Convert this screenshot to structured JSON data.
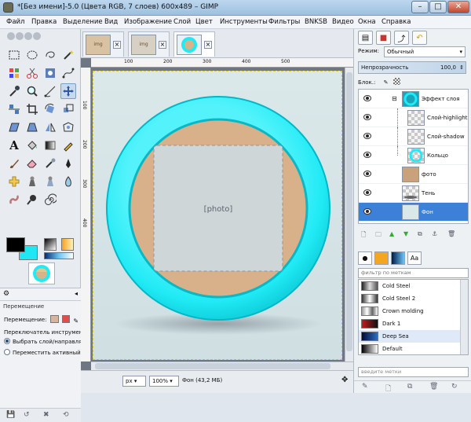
{
  "window": {
    "title": "*[Без имени]-5.0 (Цвета RGB, 7 слоев) 600x489 – GIMP",
    "minimize": "–",
    "maximize": "□",
    "close": "✕"
  },
  "menu": [
    "Файл",
    "Правка",
    "Выделение",
    "Вид",
    "Изображение",
    "Слой",
    "Цвет",
    "Инструменты",
    "Фильтры",
    "BNKSB",
    "Видео",
    "Окна",
    "Справка"
  ],
  "tool_options": {
    "title": "Перемещение",
    "move_label": "Перемещение:",
    "switch_label": "Переключатель инструмента",
    "option1": "Выбрать слой/направляющую",
    "option2": "Переместить активный слой"
  },
  "image_tabs": [
    "×",
    "×",
    "×"
  ],
  "statusbar": {
    "unit": "px",
    "zoom": "100%",
    "layer_info": "Фон (43,2 МБ)"
  },
  "layers_panel": {
    "mode_label": "Режим:",
    "mode_value": "Обычный",
    "opacity_label": "Непрозрачность",
    "opacity_value": "100,0",
    "lock_label": "Блок.:",
    "layers": [
      {
        "name": "Эффект слоя",
        "selected": false
      },
      {
        "name": "Слой-highlight",
        "selected": false
      },
      {
        "name": "Слой-shadow",
        "selected": false
      },
      {
        "name": "Кольцо",
        "selected": false
      },
      {
        "name": "фото",
        "selected": false
      },
      {
        "name": "Тень",
        "selected": false
      },
      {
        "name": "Фон",
        "selected": true
      }
    ]
  },
  "gradients": {
    "filter_placeholder": "фильтр по меткам",
    "tags_placeholder": "введите метки",
    "items": [
      "Cold Steel",
      "Cold Steel 2",
      "Crown molding",
      "Dark 1",
      "Deep Sea",
      "Default"
    ]
  },
  "colors": {
    "ring": "#20eaf5",
    "selected_layer": "#3c81d7",
    "bg_color": "#1fe7f3"
  }
}
